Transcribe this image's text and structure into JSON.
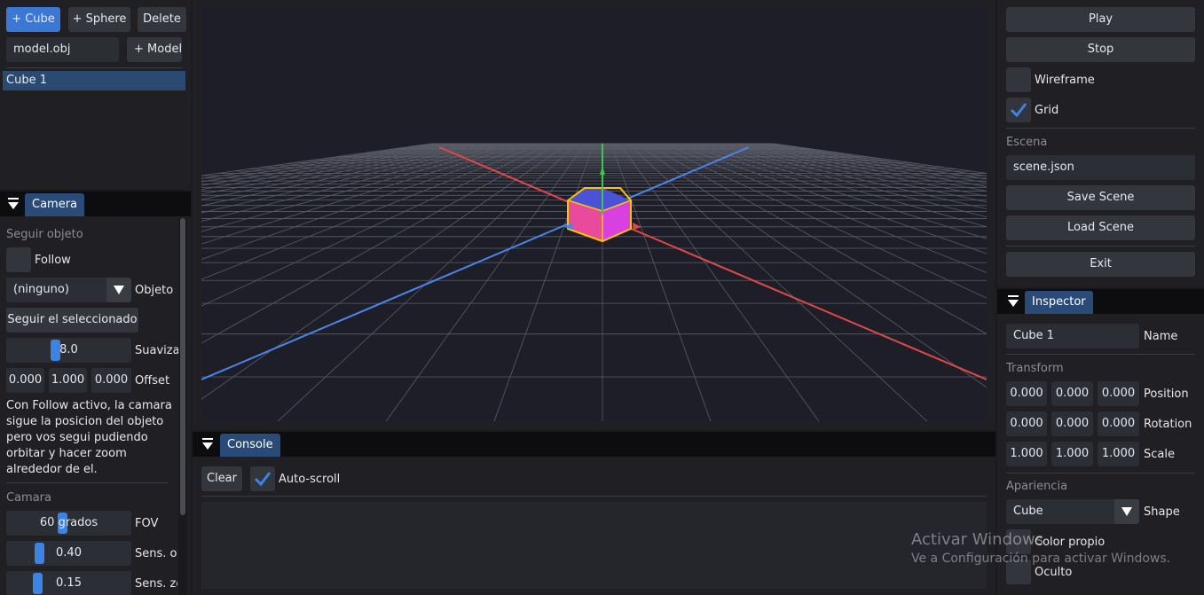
{
  "hierarchy": {
    "add_cube": "+ Cube",
    "add_sphere": "+ Sphere",
    "delete": "Delete",
    "model_path": "model.obj",
    "add_model": "+ Model",
    "items": [
      "Cube 1"
    ]
  },
  "camera_panel": {
    "tab": "Camera",
    "follow_section": "Seguir objeto",
    "follow_label": "Follow",
    "follow_checked": false,
    "object_combo": "(ninguno)",
    "object_label": "Objeto",
    "follow_selected_button": "Seguir el seleccionado",
    "smoothing_value": "8.0",
    "smoothing_label": "Suavizado",
    "offset": [
      "0.000",
      "1.000",
      "0.000"
    ],
    "offset_label": "Offset",
    "help_text": [
      "Con Follow activo, la camara",
      "sigue la posicion del objeto",
      "pero vos segui pudiendo",
      "orbitar y hacer zoom",
      "alrededor de el."
    ],
    "camera_section": "Camara",
    "fov_value": "60 grados",
    "fov_label": "FOV",
    "sens_orbit_value": "0.40",
    "sens_orbit_label": "Sens. orbita",
    "sens_zoom_value": "0.15",
    "sens_zoom_label": "Sens. zoom"
  },
  "console": {
    "tab": "Console",
    "clear": "Clear",
    "autoscroll_label": "Auto-scroll",
    "autoscroll_checked": true
  },
  "controls": {
    "play": "Play",
    "stop": "Stop",
    "wireframe_label": "Wireframe",
    "wireframe_checked": false,
    "grid_label": "Grid",
    "grid_checked": true,
    "scene_section": "Escena",
    "scene_file": "scene.json",
    "save_scene": "Save Scene",
    "load_scene": "Load Scene",
    "exit": "Exit"
  },
  "inspector": {
    "tab": "Inspector",
    "name_value": "Cube 1",
    "name_label": "Name",
    "transform_section": "Transform",
    "position": [
      "0.000",
      "0.000",
      "0.000"
    ],
    "position_label": "Position",
    "rotation": [
      "0.000",
      "0.000",
      "0.000"
    ],
    "rotation_label": "Rotation",
    "scale": [
      "1.000",
      "1.000",
      "1.000"
    ],
    "scale_label": "Scale",
    "appearance_section": "Apariencia",
    "shape_value": "Cube",
    "shape_label": "Shape",
    "own_color_label": "Color propio",
    "hidden_label": "Oculto"
  },
  "watermark": {
    "title": "Activar Windows",
    "subtitle": "Ve a Configuración para activar Windows."
  },
  "colors": {
    "accent": "#3b78d6",
    "x_axis": "#e04848",
    "y_axis": "#3cc84a",
    "z_axis": "#4a86e8",
    "selection": "#ffc400",
    "cube": "#e040e0"
  },
  "icons": [
    "checkmark-icon",
    "collapse-triangle-icon",
    "dropdown-arrow-icon"
  ]
}
